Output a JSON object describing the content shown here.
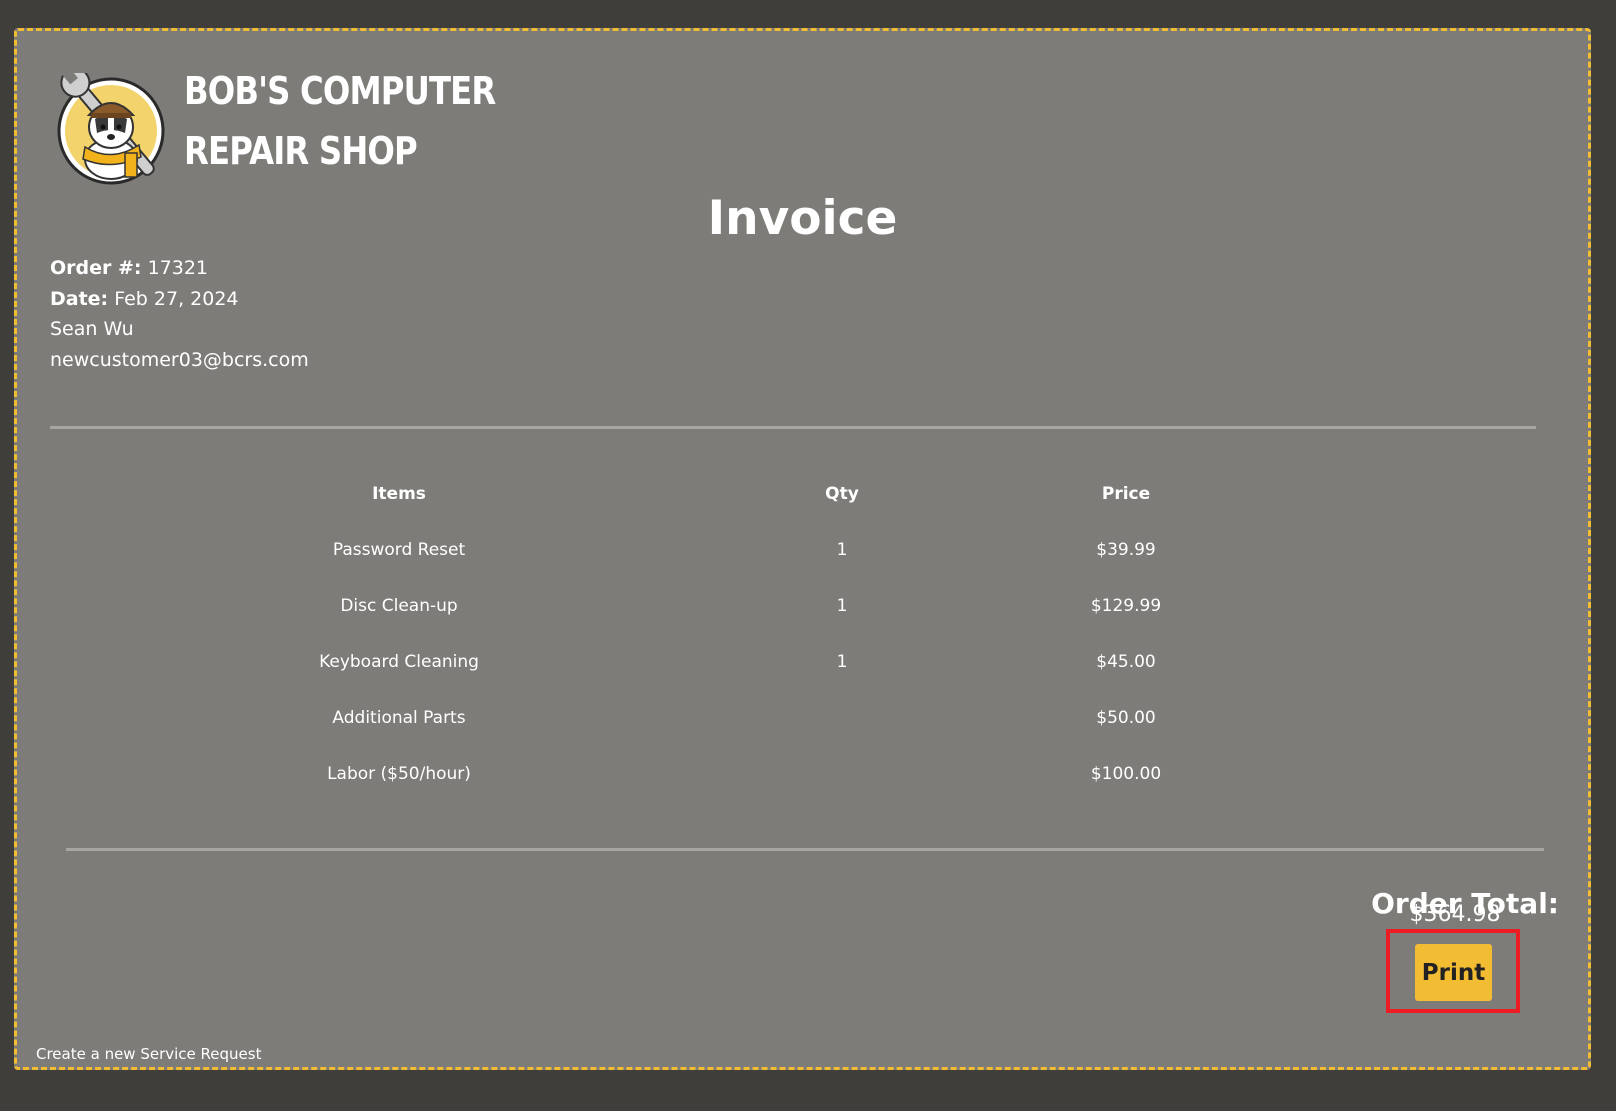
{
  "header": {
    "shop_name_line1": "BOB'S COMPUTER",
    "shop_name_line2": "REPAIR SHOP",
    "logo_icon": "badger-mechanic-logo"
  },
  "invoice": {
    "title": "Invoice",
    "order_label": "Order #:",
    "order_number": "17321",
    "date_label": "Date:",
    "date": "Feb 27, 2024",
    "customer_name": "Sean Wu",
    "customer_email": "newcustomer03@bcrs.com"
  },
  "table": {
    "headers": {
      "items": "Items",
      "qty": "Qty",
      "price": "Price"
    },
    "rows": [
      {
        "item": "Password Reset",
        "qty": "1",
        "price": "$39.99"
      },
      {
        "item": "Disc Clean-up",
        "qty": "1",
        "price": "$129.99"
      },
      {
        "item": "Keyboard Cleaning",
        "qty": "1",
        "price": "$45.00"
      },
      {
        "item": "Additional Parts",
        "qty": "",
        "price": "$50.00"
      },
      {
        "item": "Labor ($50/hour)",
        "qty": "",
        "price": "$100.00"
      }
    ]
  },
  "summary": {
    "total_label": "Order Total:",
    "total_value": "$364.98"
  },
  "actions": {
    "print_label": "Print"
  },
  "footer": {
    "link_text": "Create a new Service Request"
  },
  "colors": {
    "page_bg": "#3f3e3b",
    "panel_bg": "#7e7c79",
    "accent": "#f2bc33",
    "highlight": "#ec1c24"
  }
}
